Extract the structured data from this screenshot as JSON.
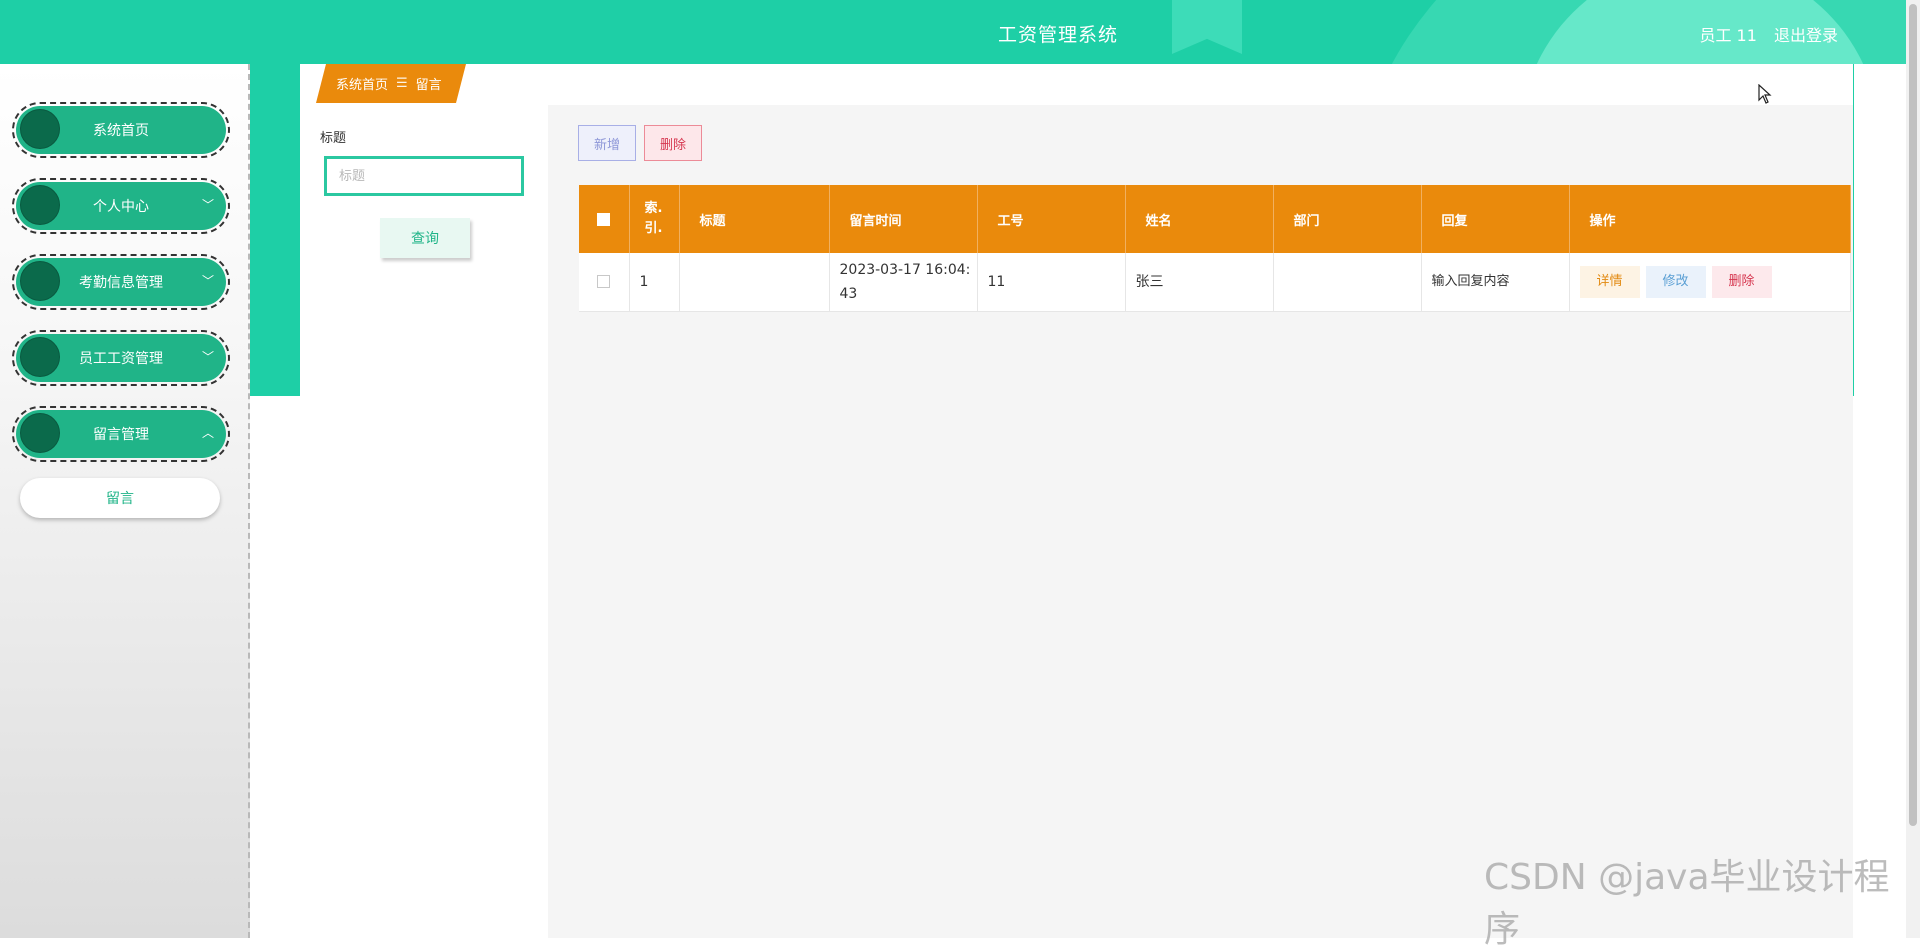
{
  "header": {
    "title": "工资管理系统",
    "user_label": "员工 11",
    "logout_label": "退出登录"
  },
  "sidebar": {
    "items": [
      {
        "label": "系统首页",
        "chevron": ""
      },
      {
        "label": "个人中心",
        "chevron": "﹀"
      },
      {
        "label": "考勤信息管理",
        "chevron": "﹀"
      },
      {
        "label": "员工工资管理",
        "chevron": "﹀"
      },
      {
        "label": "留言管理",
        "chevron": "︿"
      }
    ],
    "sub_item": "留言"
  },
  "breadcrumb": {
    "home": "系统首页",
    "sep": "☰",
    "current": "留言"
  },
  "filter": {
    "label": "标题",
    "placeholder": "标题",
    "query_button": "查询"
  },
  "toolbar": {
    "add_label": "新增",
    "delete_label": "删除"
  },
  "table": {
    "headers": [
      "索引",
      "标题",
      "留言时间",
      "工号",
      "姓名",
      "部门",
      "回复",
      "操作"
    ],
    "index_header_lines": [
      "索.",
      "引."
    ],
    "rows": [
      {
        "index": "1",
        "title": "",
        "time": "2023-03-17 16:04:43",
        "emp_no": "11",
        "name": "张三",
        "dept": "",
        "reply": "输入回复内容"
      }
    ],
    "ops": {
      "detail": "详情",
      "edit": "修改",
      "delete": "删除"
    }
  },
  "watermark": "CSDN @java毕业设计程序",
  "colors": {
    "topbar": "#1ecfa6",
    "sidebar_pill": "#20b488",
    "table_header": "#ea8a0c",
    "breadcrumb": "#ea8a0c"
  }
}
